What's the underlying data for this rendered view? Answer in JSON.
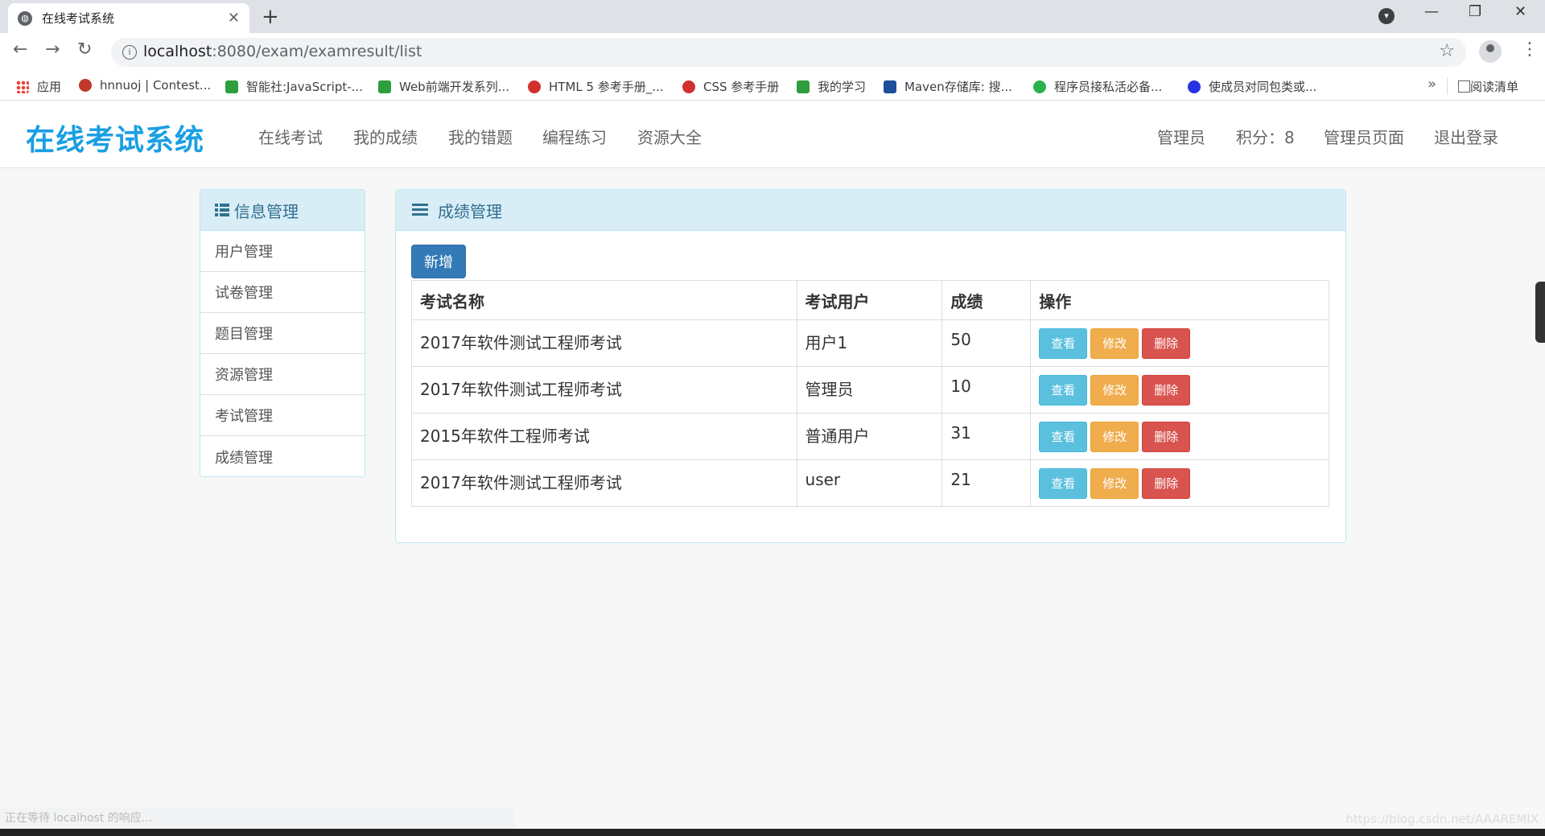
{
  "browser": {
    "tab_title": "在线考试系统",
    "tab_close": "✕",
    "new_tab": "+",
    "win_min": "—",
    "win_max": "❐",
    "win_close": "✕",
    "url_host": "localhost",
    "url_path": ":8080/exam/examresult/list",
    "back": "←",
    "forward": "→",
    "reload": "↻",
    "star": "☆",
    "menu": "⋮",
    "bookmarks": [
      {
        "label": "应用",
        "color": "#e94235"
      },
      {
        "label": "hnnuoj | Contest...",
        "color": "#c0392b"
      },
      {
        "label": "智能社:JavaScript-...",
        "color": "#2e9e3f"
      },
      {
        "label": "Web前端开发系列...",
        "color": "#2e9e3f"
      },
      {
        "label": "HTML 5 参考手册_...",
        "color": "#d0312d"
      },
      {
        "label": "CSS 参考手册",
        "color": "#d0312d"
      },
      {
        "label": "我的学习",
        "color": "#2e9e3f"
      },
      {
        "label": "Maven存储库: 搜...",
        "color": "#1f4e9c"
      },
      {
        "label": "程序员接私活必备...",
        "color": "#2bb24c"
      },
      {
        "label": "使成员对同包类或...",
        "color": "#2932e1"
      }
    ],
    "bm_more": "»",
    "reading_list": "阅读清单"
  },
  "site": {
    "brand": "在线考试系统",
    "nav": [
      "在线考试",
      "我的成绩",
      "我的错题",
      "编程练习",
      "资源大全"
    ],
    "right_nav": [
      "管理员",
      "积分：8",
      "管理员页面",
      "退出登录"
    ]
  },
  "sidebar": {
    "title": "信息管理",
    "items": [
      "用户管理",
      "试卷管理",
      "题目管理",
      "资源管理",
      "考试管理",
      "成绩管理"
    ]
  },
  "main": {
    "title": "成绩管理",
    "add_label": "新增",
    "columns": [
      "考试名称",
      "考试用户",
      "成绩",
      "操作"
    ],
    "rows": [
      {
        "exam": "2017年软件测试工程师考试",
        "user": "用户1",
        "score": "50"
      },
      {
        "exam": "2017年软件测试工程师考试",
        "user": "管理员",
        "score": "10"
      },
      {
        "exam": "2015年软件工程师考试",
        "user": "普通用户",
        "score": "31"
      },
      {
        "exam": "2017年软件测试工程师考试",
        "user": "user",
        "score": "21"
      }
    ],
    "actions": {
      "view": "查看",
      "edit": "修改",
      "delete": "删除"
    }
  },
  "status": {
    "text": "正在等待 localhost 的响应...",
    "watermark": "https://blog.csdn.net/AAAREMIX"
  },
  "colors": {
    "primary": "#337ab7",
    "info": "#5bc0de",
    "warning": "#f0ad4e",
    "danger": "#d9534f",
    "brand": "#1a9fe3"
  }
}
